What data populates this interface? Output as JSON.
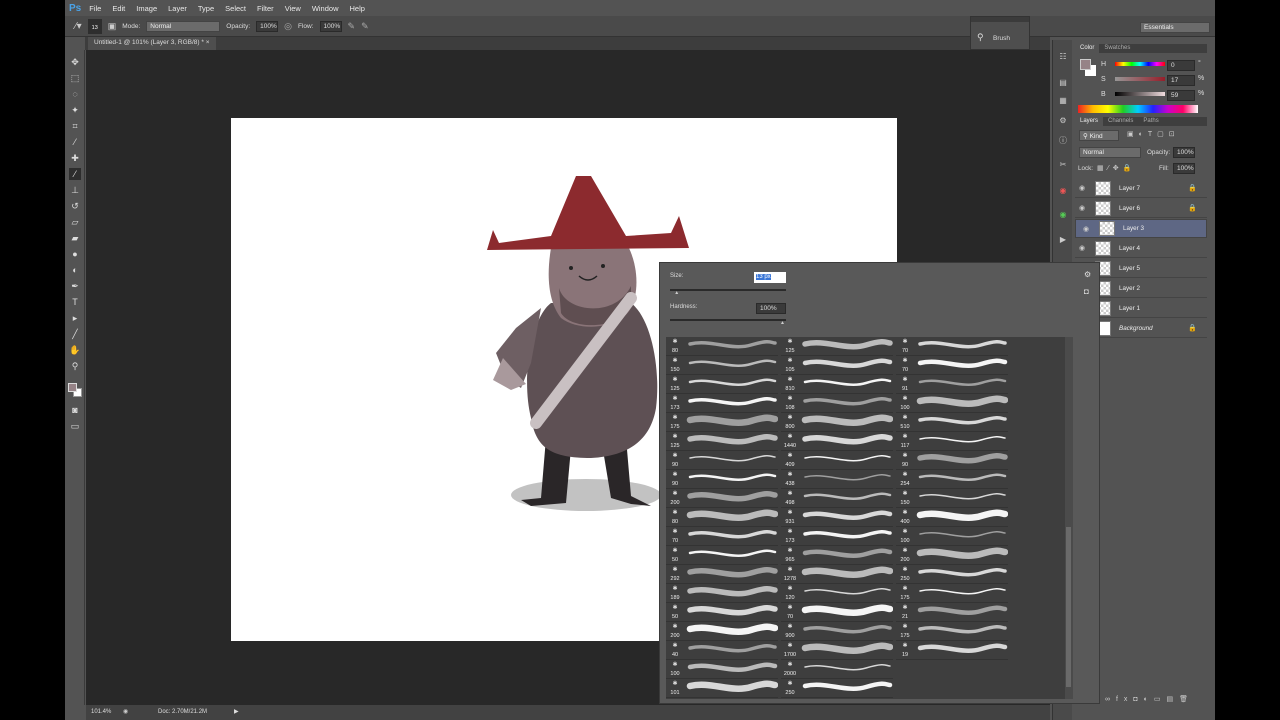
{
  "app": {
    "logo": "Ps",
    "menu": [
      "File",
      "Edit",
      "Image",
      "Layer",
      "Type",
      "Select",
      "Filter",
      "View",
      "Window",
      "Help"
    ]
  },
  "options": {
    "brush_size": "13",
    "mode_label": "Mode:",
    "mode_value": "Normal",
    "opacity_label": "Opacity:",
    "opacity_value": "100%",
    "flow_label": "Flow:",
    "flow_value": "100%"
  },
  "document": {
    "tab_title": "Untitled-1 @ 101% (Layer 3, RGB/8) *",
    "close": "×"
  },
  "status": {
    "zoom": "101.4%",
    "doc": "Doc: 2.70M/21.2M"
  },
  "workspace_switcher": "Essentials",
  "brush_panel_collapsed": {
    "label": "Brush"
  },
  "color_panel": {
    "tabs": [
      "Color",
      "Swatches"
    ],
    "active_tab": "Color",
    "h_label": "H",
    "h_value": "0",
    "h_unit": "°",
    "s_label": "S",
    "s_value": "17",
    "s_unit": "%",
    "b_label": "B",
    "b_value": "59",
    "b_unit": "%",
    "foreground": "#968387",
    "background": "#ffffff"
  },
  "layers_panel": {
    "tabs": [
      "Layers",
      "Channels",
      "Paths"
    ],
    "active_tab": "Layers",
    "filter": "Kind",
    "blend": "Normal",
    "opacity_label": "Opacity:",
    "opacity_value": "100%",
    "lock_label": "Lock:",
    "fill_label": "Fill:",
    "fill_value": "100%",
    "layers": [
      {
        "name": "Layer 7",
        "locked": true,
        "selected": false
      },
      {
        "name": "Layer 6",
        "locked": true,
        "selected": false
      },
      {
        "name": "Layer 3",
        "locked": false,
        "selected": true
      },
      {
        "name": "Layer 4",
        "locked": false,
        "selected": false
      },
      {
        "name": "Layer 5",
        "locked": false,
        "selected": false
      },
      {
        "name": "Layer 2",
        "locked": false,
        "selected": false
      },
      {
        "name": "Layer 1",
        "locked": false,
        "selected": false
      },
      {
        "name": "Background",
        "locked": true,
        "selected": false
      }
    ]
  },
  "brush_picker": {
    "size_label": "Size:",
    "size_value": "13 px",
    "size_fraction": 0.02,
    "hardness_label": "Hardness:",
    "hardness_value": "100%",
    "hardness_fraction": 1.0,
    "columns": [
      [
        "80",
        "150",
        "125",
        "173",
        "175",
        "125",
        "90",
        "90",
        "200",
        "80",
        "70",
        "50",
        "292",
        "189",
        "50",
        "200",
        "40",
        "100",
        "101"
      ],
      [
        "125",
        "105",
        "810",
        "108",
        "800",
        "1440",
        "409",
        "438",
        "498",
        "931",
        "173",
        "965",
        "1278",
        "120",
        "70",
        "900",
        "1700",
        "2000",
        "250"
      ],
      [
        "70",
        "70",
        "91",
        "100",
        "510",
        "117",
        "90",
        "254",
        "150",
        "400",
        "100",
        "200",
        "250",
        "175",
        "21",
        "175",
        "19"
      ]
    ]
  }
}
